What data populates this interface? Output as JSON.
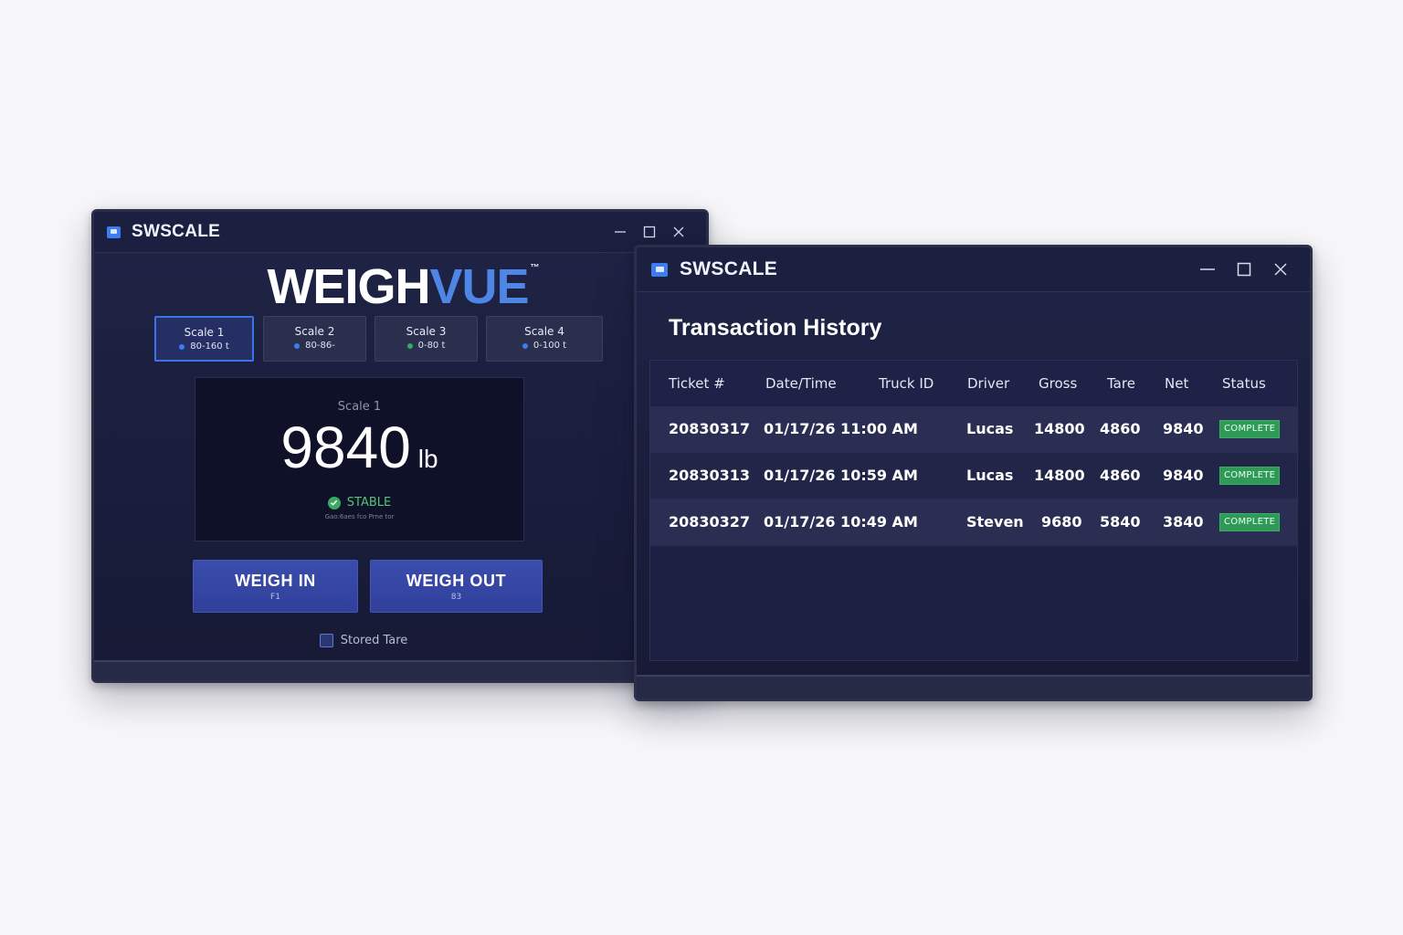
{
  "scale_window": {
    "app_title": "SWSCALE",
    "logo": {
      "part1": "WEIGH",
      "part2": "VUE",
      "tm": "™"
    },
    "scales": [
      {
        "name": "Scale 1",
        "range": "80-160 t",
        "dot_color": "#3d7df0",
        "active": true
      },
      {
        "name": "Scale 2",
        "range": "80-86-",
        "dot_color": "#3d7df0",
        "active": false
      },
      {
        "name": "Scale 3",
        "range": "0-80 t",
        "dot_color": "#3aa863",
        "active": false
      },
      {
        "name": "Scale 4",
        "range": "0-100 t",
        "dot_color": "#3d7df0",
        "active": false
      }
    ],
    "display": {
      "label": "Scale 1",
      "weight": "9840",
      "unit": "lb",
      "status": "STABLE",
      "substatus": "Gao:6aes fco Prne tor"
    },
    "weigh_in": {
      "label": "WEIGH IN",
      "key": "F1"
    },
    "weigh_out": {
      "label": "WEIGH OUT",
      "key": "83"
    },
    "stored_tare": {
      "label": "Stored Tare",
      "checked": false
    }
  },
  "history_window": {
    "app_title": "SWSCALE",
    "title": "Transaction History",
    "columns": [
      "Ticket #",
      "Date/Time",
      "Truck ID",
      "Driver",
      "Gross",
      "Tare",
      "Net",
      "Status"
    ],
    "rows": [
      {
        "ticket": "20830317",
        "datetime": "01/17/26 11:00 AM",
        "truck": "",
        "driver": "Lucas",
        "gross": "14800",
        "tare": "4860",
        "net": "9840",
        "status": "COMPLETE"
      },
      {
        "ticket": "20830313",
        "datetime": "01/17/26 10:59 AM",
        "truck": "",
        "driver": "Lucas",
        "gross": "14800",
        "tare": "4860",
        "net": "9840",
        "status": "COMPLETE"
      },
      {
        "ticket": "20830327",
        "datetime": "01/17/26 10:49 AM",
        "truck": "",
        "driver": "Steven",
        "gross": "9680",
        "tare": "5840",
        "net": "3840",
        "status": "COMPLETE"
      }
    ]
  },
  "colors": {
    "accent": "#3d7df0",
    "logo_blue": "#4e86e6",
    "stable_green": "#55c27a",
    "complete_badge": "#2f9a57"
  },
  "icons": [
    "app-icon",
    "minimize-icon",
    "maximize-icon",
    "close-icon",
    "check-icon"
  ]
}
